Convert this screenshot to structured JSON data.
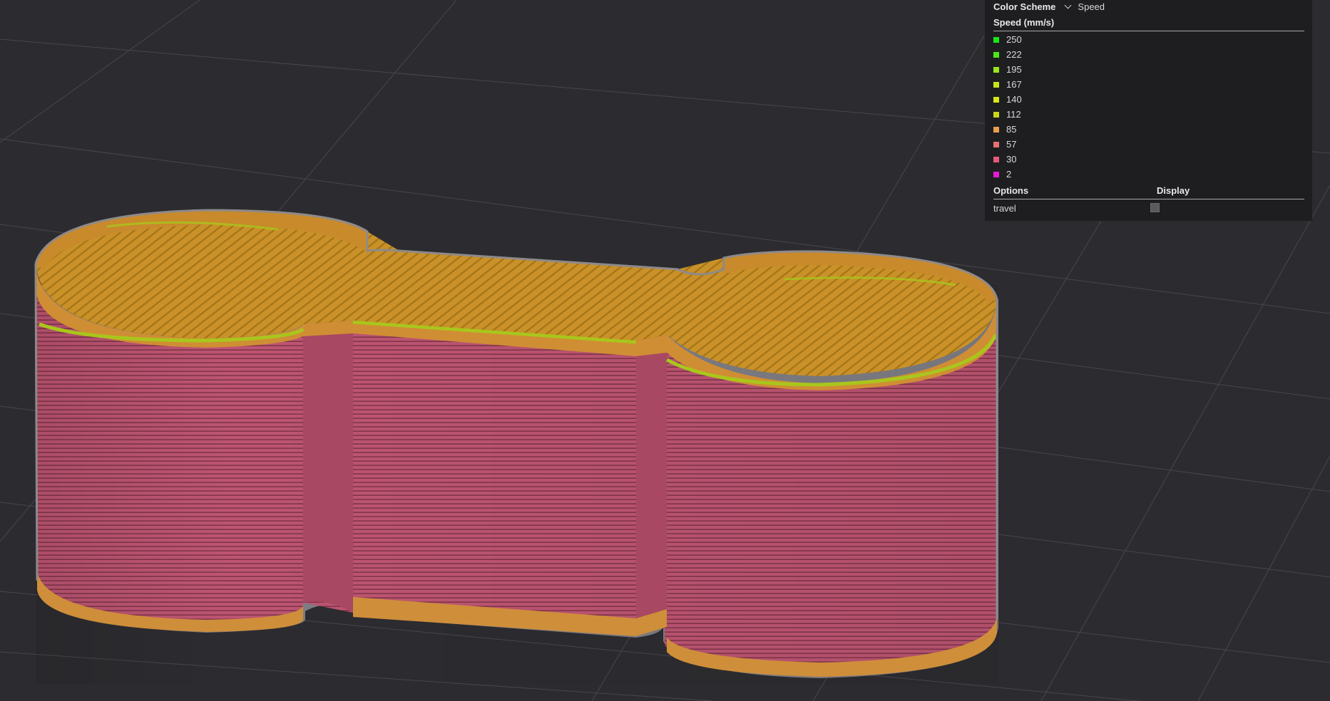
{
  "legend": {
    "color_scheme_label": "Color Scheme",
    "color_scheme_value": "Speed",
    "speed_title": "Speed (mm/s)",
    "items": [
      {
        "label": "250",
        "color": "#19e619"
      },
      {
        "label": "222",
        "color": "#4ee619"
      },
      {
        "label": "195",
        "color": "#9be619"
      },
      {
        "label": "167",
        "color": "#c6e619"
      },
      {
        "label": "140",
        "color": "#d7e619"
      },
      {
        "label": "112",
        "color": "#c9d619"
      },
      {
        "label": "85",
        "color": "#e8a050"
      },
      {
        "label": "57",
        "color": "#e87070"
      },
      {
        "label": "30",
        "color": "#e85a7a"
      },
      {
        "label": "2",
        "color": "#e619d6"
      }
    ],
    "options_title": "Options",
    "display_title": "Display",
    "travel_label": "travel",
    "travel_checked": false
  },
  "colors": {
    "background": "#2c2c30",
    "grid": "#4a4a50",
    "wall_pink": "#b8506a",
    "top_infill": "#c8922a",
    "solid_orange": "#d2913a",
    "accent_yellow": "#a8c81e",
    "outline_gray": "#8a8a90"
  }
}
